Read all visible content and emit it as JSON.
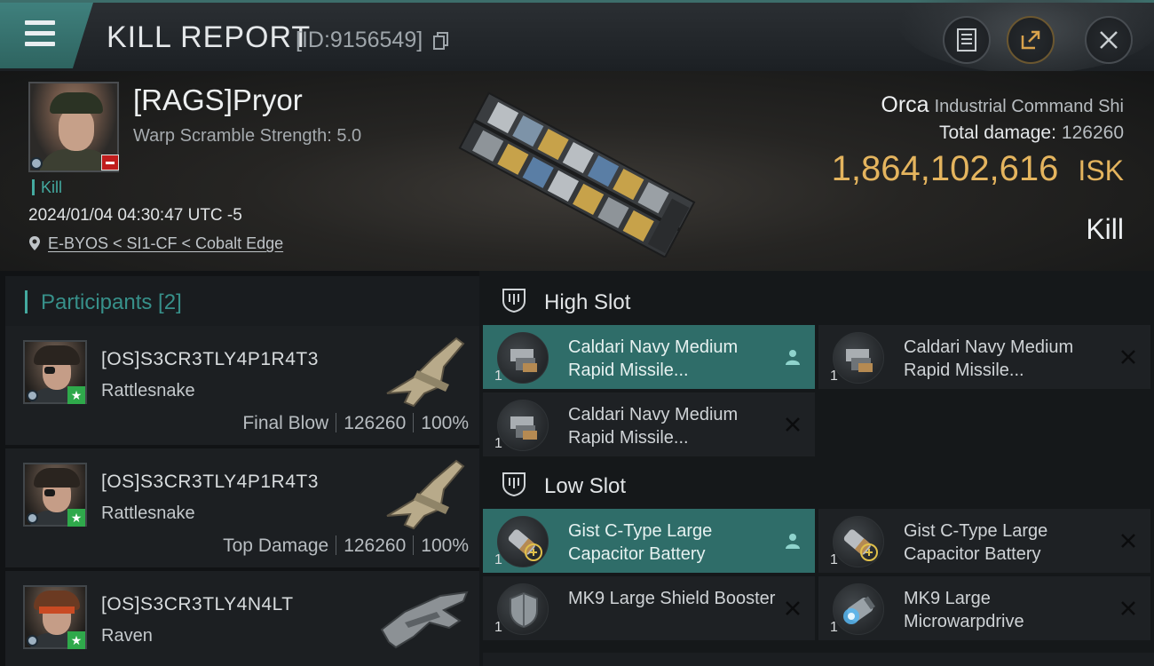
{
  "header": {
    "title": "KILL REPORT",
    "id_text": "[ID:9156549]"
  },
  "victim": {
    "name": "[RAGS]Pryor",
    "warp_info": "Warp Scramble Strength: 5.0",
    "kill_tag": "Kill",
    "datetime": "2024/01/04 04:30:47 UTC -5",
    "location": "E-BYOS < SI1-CF < Cobalt Edge",
    "ship_name": "Orca",
    "ship_class": "Industrial Command Shi",
    "total_damage_label": "Total damage:",
    "total_damage": "126260",
    "isk_value": "1,864,102,616",
    "isk_unit": "ISK",
    "result": "Kill"
  },
  "participants": {
    "title": "Participants [2]",
    "rows": [
      {
        "name": "[OS]S3CR3TLY4P1R4T3",
        "ship": "Rattlesnake",
        "role": "Final Blow",
        "damage": "126260",
        "percent": "100%"
      },
      {
        "name": "[OS]S3CR3TLY4P1R4T3",
        "ship": "Rattlesnake",
        "role": "Top Damage",
        "damage": "126260",
        "percent": "100%"
      },
      {
        "name": "[OS]S3CR3TLY4N4LT",
        "ship": "Raven"
      }
    ]
  },
  "fitting": {
    "high_slot": {
      "title": "High Slot",
      "modules": [
        {
          "name": "Caldari Navy Medium Rapid Missile...",
          "qty": "1",
          "icon": "missile-launcher-icon",
          "action": "pilot-icon"
        },
        {
          "name": "Caldari Navy Medium Rapid Missile...",
          "qty": "1",
          "icon": "missile-launcher-icon",
          "action": "close-icon"
        },
        {
          "name": "Caldari Navy Medium Rapid Missile...",
          "qty": "1",
          "icon": "missile-launcher-icon",
          "action": "close-icon"
        }
      ]
    },
    "low_slot": {
      "title": "Low Slot",
      "modules": [
        {
          "name": "Gist C-Type Large Capacitor Battery",
          "qty": "1",
          "icon": "capacitor-battery-icon",
          "action": "pilot-icon"
        },
        {
          "name": "Gist C-Type Large Capacitor Battery",
          "qty": "1",
          "icon": "capacitor-battery-icon",
          "action": "close-icon"
        },
        {
          "name": "MK9 Large Shield Booster",
          "qty": "1",
          "icon": "shield-booster-icon",
          "action": "close-icon"
        },
        {
          "name": "MK9 Large Microwarpdrive",
          "qty": "1",
          "icon": "microwarpdrive-icon",
          "action": "close-icon"
        }
      ]
    }
  },
  "colors": {
    "accent_teal": "#2f6d69",
    "isk_gold": "#e4b45e",
    "badge_red": "#c01d1d",
    "badge_green": "#2fa94b"
  }
}
